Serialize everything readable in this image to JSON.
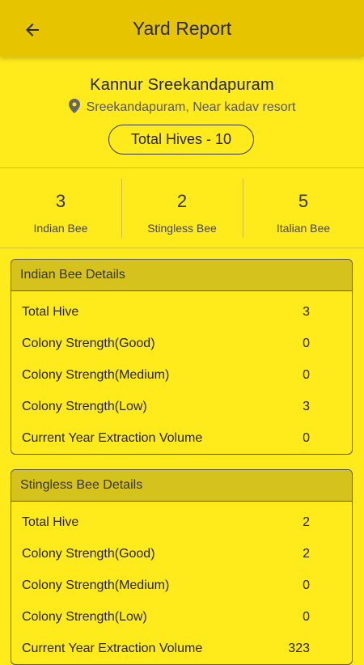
{
  "appbar": {
    "title": "Yard Report",
    "back_icon": "arrow-left-icon"
  },
  "yard": {
    "name": "Kannur Sreekandapuram",
    "location": "Sreekandapuram, Near kadav resort",
    "total_hives": "Total Hives - 10"
  },
  "stats": [
    {
      "value": "3",
      "label": "Indian Bee"
    },
    {
      "value": "2",
      "label": "Stingless Bee"
    },
    {
      "value": "5",
      "label": "Italian Bee"
    }
  ],
  "sections": [
    {
      "title": "Indian Bee Details",
      "rows": [
        {
          "label": "Total Hive",
          "value": "3"
        },
        {
          "label": "Colony Strength(Good)",
          "value": "0"
        },
        {
          "label": "Colony Strength(Medium)",
          "value": "0"
        },
        {
          "label": "Colony Strength(Low)",
          "value": "3"
        },
        {
          "label": "Current Year Extraction Volume",
          "value": "0"
        }
      ]
    },
    {
      "title": "Stingless Bee Details",
      "rows": [
        {
          "label": "Total Hive",
          "value": "2"
        },
        {
          "label": "Colony Strength(Good)",
          "value": "2"
        },
        {
          "label": "Colony Strength(Medium)",
          "value": "0"
        },
        {
          "label": "Colony Strength(Low)",
          "value": "0"
        },
        {
          "label": "Current Year Extraction Volume",
          "value": "323"
        }
      ]
    }
  ],
  "colors": {
    "background": "#ffea1c",
    "appbar": "#e6c400",
    "section_header": "#d5c21c"
  }
}
